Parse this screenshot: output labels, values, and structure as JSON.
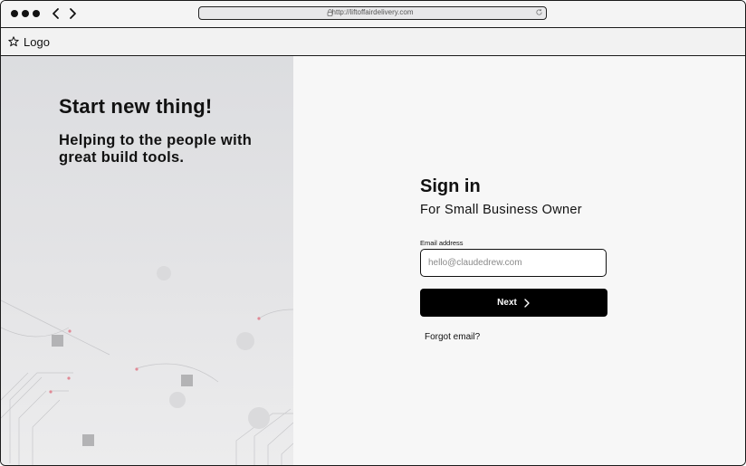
{
  "browser": {
    "url": "http://liftoffairdelivery.com"
  },
  "header": {
    "logo_icon": "star-icon",
    "logo_text": "Logo"
  },
  "hero": {
    "title": "Start new thing!",
    "subtitle": "Helping to the people with great build tools."
  },
  "signin": {
    "title": "Sign in",
    "subtitle": "For Small Business Owner",
    "email_label": "Email address",
    "email_placeholder": "hello@claudedrew.com",
    "email_value": "",
    "next_label": "Next",
    "next_icon": "chevron-right-icon",
    "forgot_label": "Forgot email?"
  },
  "colors": {
    "primary_button": "#000000",
    "left_panel_bg": "#dcdde0",
    "right_panel_bg": "#f7f7f7"
  }
}
